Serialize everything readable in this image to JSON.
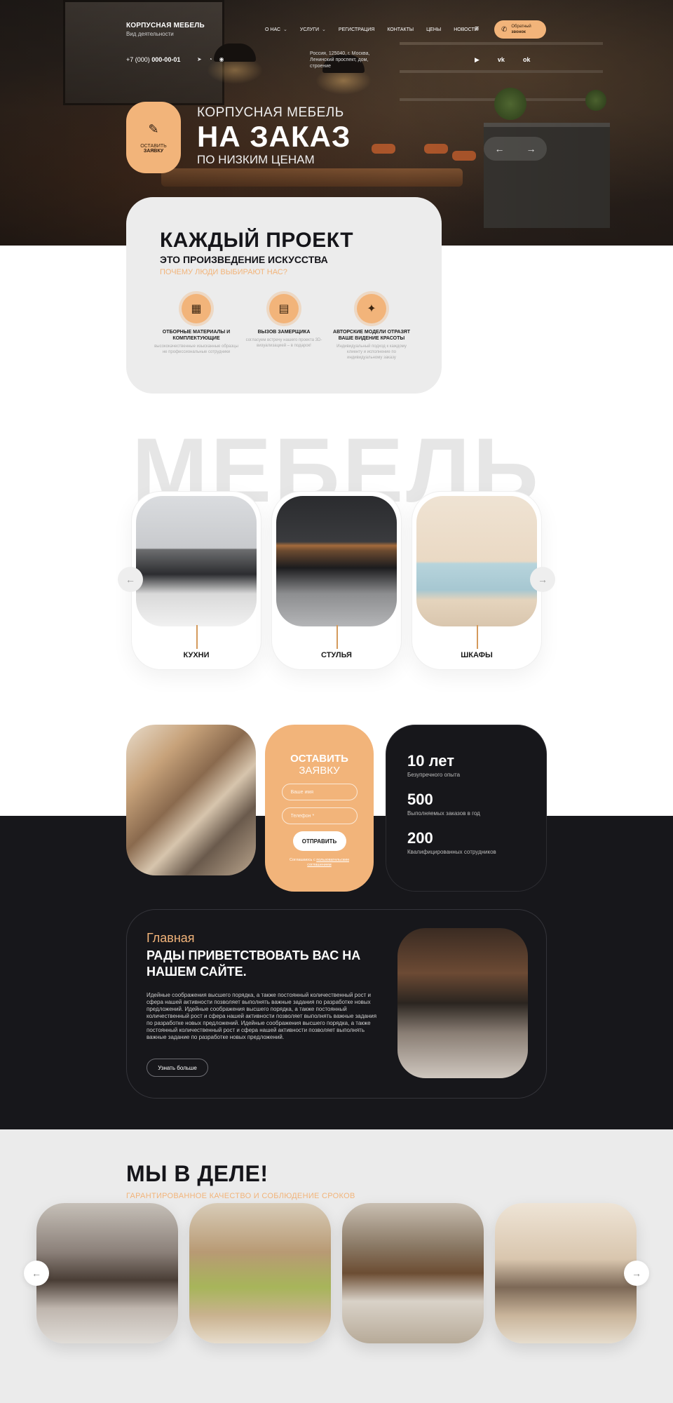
{
  "header": {
    "brand_name": "КОРПУСНАЯ МЕБЕЛЬ",
    "brand_sub": "Вид деятельности",
    "nav": [
      "О НАС",
      "УСЛУГИ",
      "РЕГИСТРАЦИЯ",
      "КОНТАКТЫ",
      "ЦЕНЫ",
      "НОВОСТИ"
    ],
    "call_line1": "Обратный",
    "call_line2": "звонок",
    "phone_prefix": "+7 (000)",
    "phone_number": "000-00-01",
    "address": "Россия, 125040, г. Москва, Ленинский проспект, дом, строение",
    "social": [
      "youtube-icon",
      "vk-icon",
      "ok-icon"
    ]
  },
  "hero": {
    "badge_line1": "ОСТАВИТЬ",
    "badge_line2": "ЗАЯВКУ",
    "title_top": "КОРПУСНАЯ МЕБЕЛЬ",
    "title_main": "НА ЗАКАЗ",
    "title_bottom": "ПО НИЗКИМ ЦЕНАМ"
  },
  "project": {
    "title": "КАЖДЫЙ ПРОЕКТ",
    "subtitle": "ЭТО ПРОИЗВЕДЕНИЕ ИСКУССТВА",
    "question": "ПОЧЕМУ ЛЮДИ ВЫБИРАЮТ НАС?",
    "features": [
      {
        "title": "ОТБОРНЫЕ МАТЕРИАЛЫ И КОМПЛЕКТУЮЩИЕ",
        "text": "высококачественные изысканные образцы не профессиональные сотрудники"
      },
      {
        "title": "ВЫЗОВ ЗАМЕРЩИКА",
        "text": "согласуем встречу нашего проекта 3D-визуализацией – в подарок!"
      },
      {
        "title": "АВТОРСКИЕ МОДЕЛИ ОТРАЗЯТ ВАШЕ ВИДЕНИЕ КРАСОТЫ",
        "text": "Индивидуальный подход к каждому клиенту и исполнение по индивидуальному заказу"
      }
    ]
  },
  "furniture": {
    "big_word": "МЕБЕЛЬ",
    "categories": [
      "КУХНИ",
      "СТУЛЬЯ",
      "ШКАФЫ"
    ]
  },
  "form": {
    "title1": "ОСТАВИТЬ",
    "title2": "ЗАЯВКУ",
    "name_placeholder": "Ваше имя",
    "phone_placeholder": "Телефон *",
    "submit": "ОТПРАВИТЬ",
    "agree_text": "Соглашаюсь с",
    "agree_link": "пользовательским соглашением"
  },
  "stats": [
    {
      "value": "10 лет",
      "label": "Безупречного опыта"
    },
    {
      "value": "500",
      "label": "Выполняемых заказов в год"
    },
    {
      "value": "200",
      "label": "Квалифицированных сотрудников"
    }
  ],
  "welcome": {
    "overline": "Главная",
    "title": "РАДЫ ПРИВЕТСТВОВАТЬ ВАС НА НАШЕМ САЙТЕ.",
    "body": "Идейные соображения высшего порядка, а также постоянный количественный рост и сфера нашей активности позволяет выполнять важные задания по разработке новых предложений.  Идейные соображения высшего порядка, а также постоянный количественный рост и сфера нашей активности позволяет выполнять важные задания по разработке новых предложений. Идейные соображения высшего порядка, а также постоянный количественный рост и сфера нашей активности позволяет выполнять важные задание по разработке новых предложений.",
    "more_button": "Узнать больше"
  },
  "action": {
    "title": "МЫ В ДЕЛЕ!",
    "subtitle": "ГАРАНТИРОВАННОЕ КАЧЕСТВО И СОБЛЮДЕНИЕ СРОКОВ"
  },
  "colors": {
    "accent": "#f2b47a",
    "dark": "#17171b",
    "light": "#ececec"
  }
}
